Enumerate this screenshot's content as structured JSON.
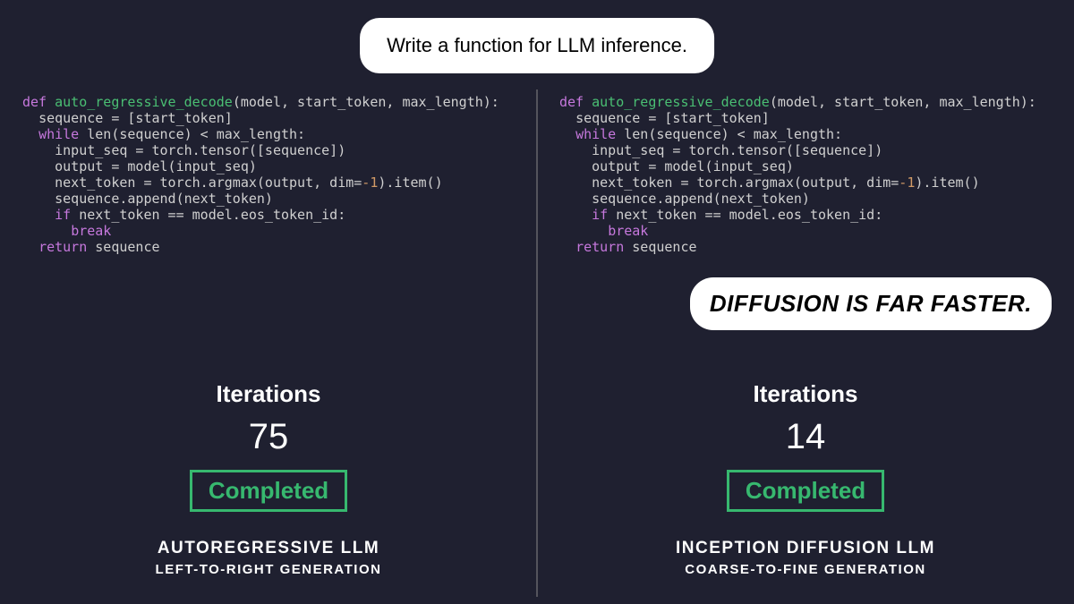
{
  "prompt": "Write a function for LLM inference.",
  "code": {
    "def": "def",
    "fn_name": "auto_regressive_decode",
    "params": "(model, start_token, max_length):",
    "l2": "sequence = [start_token]",
    "while": "while",
    "l3b": " len(sequence) < max_length:",
    "l4": "input_seq = torch.tensor([sequence])",
    "l5": "output = model(input_seq)",
    "l6a": "next_token = torch.argmax(output, dim=",
    "neg1": "-1",
    "l6b": ").item()",
    "l7": "sequence.append(next_token)",
    "if": "if",
    "l8b": " next_token == model.eos_token_id:",
    "break": "break",
    "return": "return",
    "l10b": " sequence"
  },
  "left": {
    "iter_label": "Iterations",
    "iter_value": "75",
    "status": "Completed",
    "title": "AUTOREGRESSIVE LLM",
    "subtitle": "LEFT-TO-RIGHT GENERATION"
  },
  "right": {
    "iter_label": "Iterations",
    "iter_value": "14",
    "status": "Completed",
    "title": "INCEPTION DIFFUSION LLM",
    "subtitle": "COARSE-TO-FINE GENERATION",
    "callout": "DIFFUSION IS FAR FASTER."
  }
}
